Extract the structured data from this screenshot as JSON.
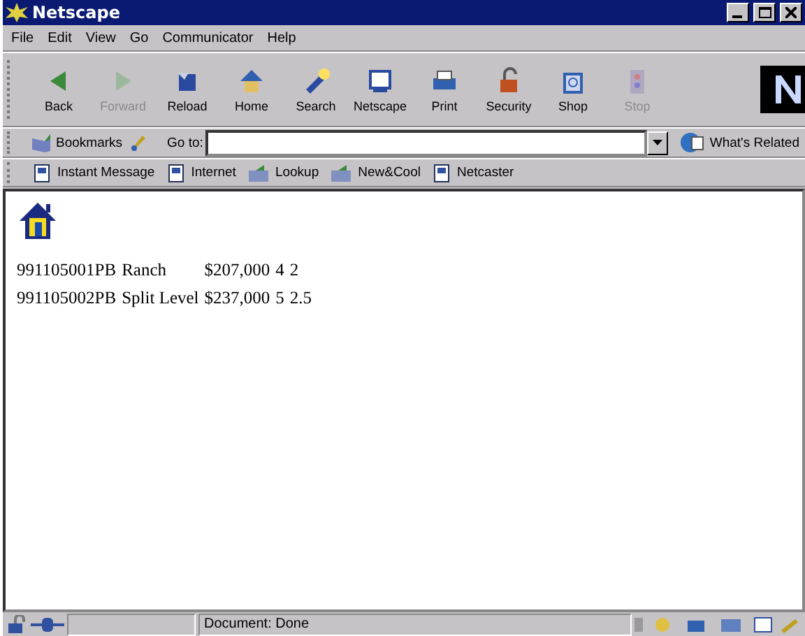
{
  "window": {
    "title": "Netscape"
  },
  "menu": [
    "File",
    "Edit",
    "View",
    "Go",
    "Communicator",
    "Help"
  ],
  "toolbar": [
    {
      "label": "Back",
      "disabled": false
    },
    {
      "label": "Forward",
      "disabled": true
    },
    {
      "label": "Reload",
      "disabled": false
    },
    {
      "label": "Home",
      "disabled": false
    },
    {
      "label": "Search",
      "disabled": false
    },
    {
      "label": "Netscape",
      "disabled": false
    },
    {
      "label": "Print",
      "disabled": false
    },
    {
      "label": "Security",
      "disabled": false
    },
    {
      "label": "Shop",
      "disabled": false
    },
    {
      "label": "Stop",
      "disabled": true
    }
  ],
  "location_bar": {
    "bookmarks": "Bookmarks",
    "goto_label": "Go to:",
    "related": "What's Related"
  },
  "personal_toolbar": [
    "Instant Message",
    "Internet",
    "Lookup",
    "New&Cool",
    "Netcaster"
  ],
  "listings": [
    [
      "991105001PB",
      "Ranch",
      "$207,000",
      "4",
      "2"
    ],
    [
      "991105002PB",
      "Split Level",
      "$237,000",
      "5",
      "2.5"
    ]
  ],
  "status_bar": {
    "text": "Document: Done"
  }
}
